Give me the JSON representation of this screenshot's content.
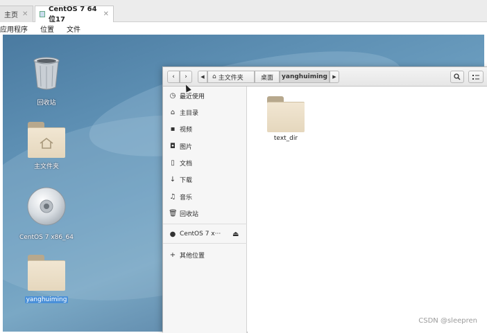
{
  "vm_tabs": [
    {
      "label": "主页",
      "active": false
    },
    {
      "label": "CentOS 7 64 位17",
      "active": true
    }
  ],
  "gnome_menu": {
    "apps": "应用程序",
    "places": "位置",
    "files": "文件"
  },
  "desktop_icons": [
    {
      "label": "回收站",
      "icon": "trash-icon",
      "selected": false
    },
    {
      "label": "主文件夹",
      "icon": "home-folder-icon",
      "selected": false
    },
    {
      "label": "CentOS 7 x86_64",
      "icon": "disc-icon",
      "selected": false
    },
    {
      "label": "yanghuiming",
      "icon": "folder-icon",
      "selected": true
    }
  ],
  "file_manager": {
    "breadcrumbs": [
      {
        "label": "主文件夹",
        "icon": "home-icon"
      },
      {
        "label": "桌面"
      },
      {
        "label": "yanghuiming",
        "current": true
      }
    ],
    "sidebar": [
      {
        "label": "最近使用",
        "icon": "clock-icon"
      },
      {
        "label": "主目录",
        "icon": "home-icon"
      },
      {
        "label": "视频",
        "icon": "video-icon"
      },
      {
        "label": "图片",
        "icon": "camera-icon"
      },
      {
        "label": "文档",
        "icon": "document-icon"
      },
      {
        "label": "下载",
        "icon": "download-icon"
      },
      {
        "label": "音乐",
        "icon": "music-icon"
      },
      {
        "label": "回收站",
        "icon": "trash-icon"
      },
      {
        "label": "CentOS 7 x···",
        "icon": "disc-icon"
      },
      {
        "label": "其他位置",
        "icon": "plus-icon"
      }
    ],
    "files": [
      {
        "name": "text_dir",
        "icon": "folder-icon"
      }
    ]
  },
  "watermark": "CSDN @sleepren"
}
